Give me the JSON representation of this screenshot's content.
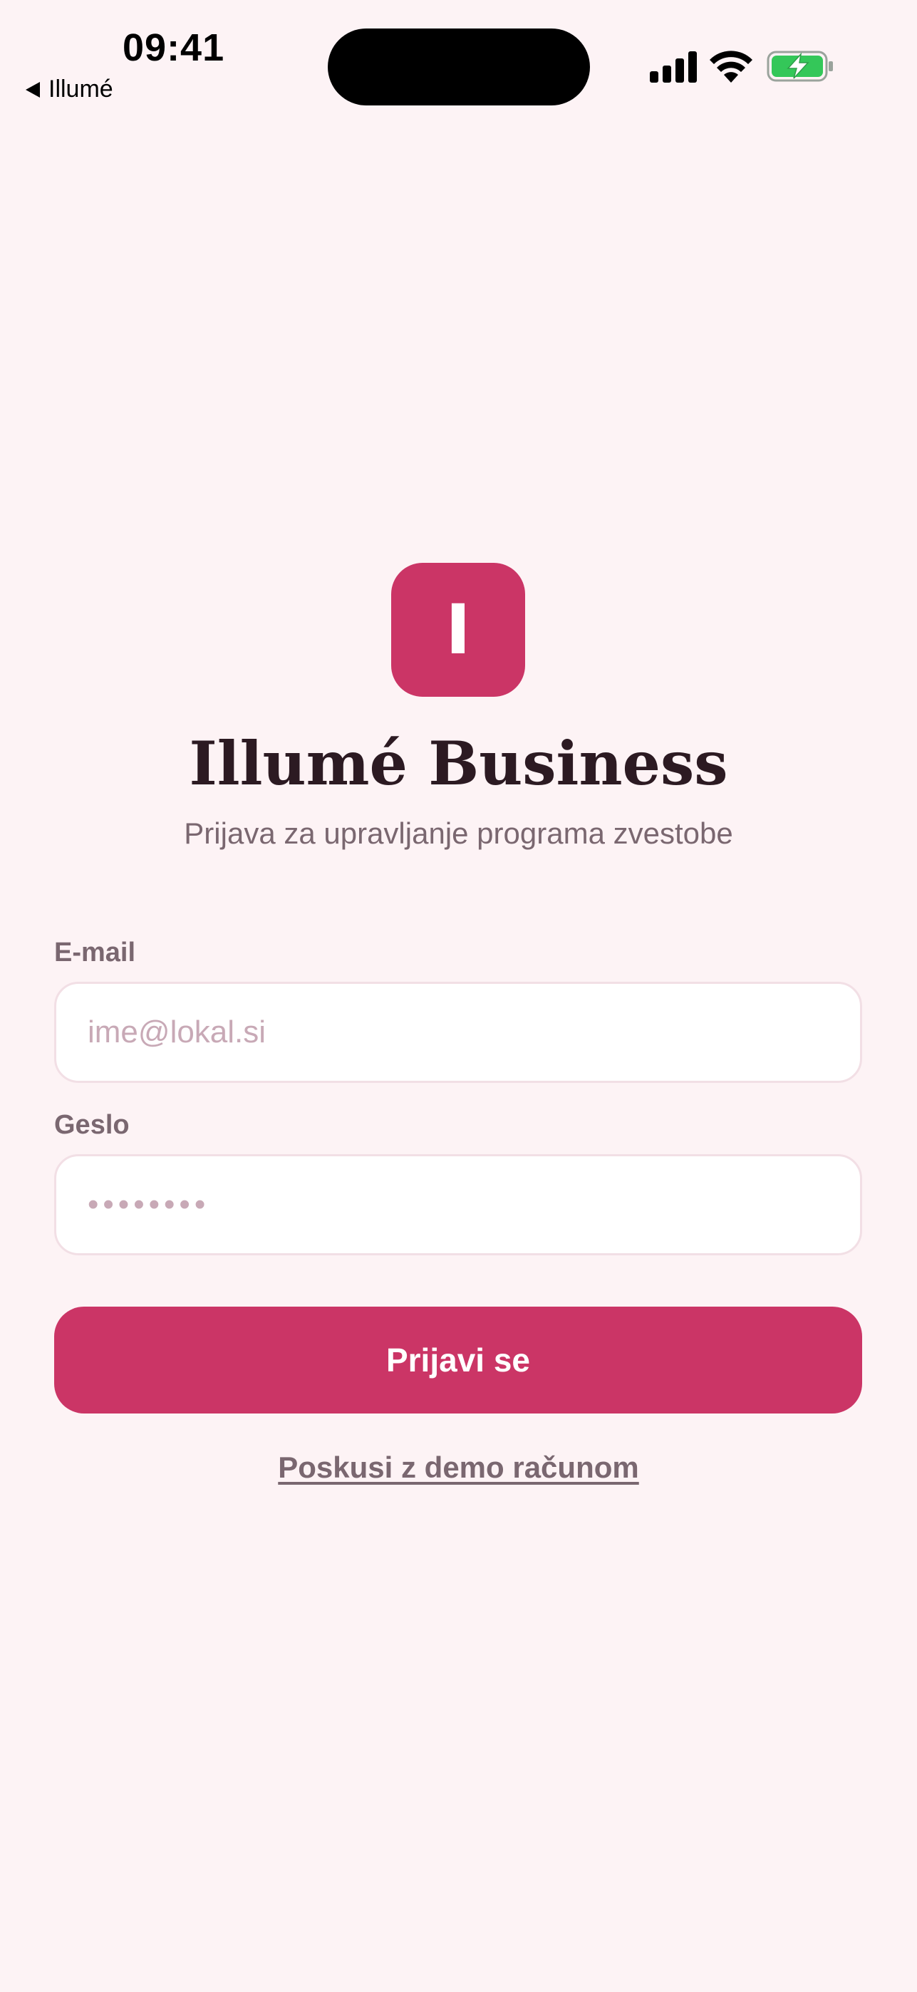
{
  "status_bar": {
    "time": "09:41",
    "back_label": "Illumé",
    "icons": [
      "cellular-signal-icon",
      "wifi-icon",
      "battery-charging-icon"
    ],
    "battery_color": "#34c759"
  },
  "brand": {
    "logo_letter": "I",
    "title": "Illumé Business",
    "subtitle": "Prijava za upravljanje programa zvestobe",
    "accent_color": "#cb3566"
  },
  "form": {
    "email": {
      "label": "E-mail",
      "placeholder": "ime@lokal.si",
      "value": ""
    },
    "password": {
      "label": "Geslo",
      "placeholder": "••••••••",
      "value": ""
    },
    "submit_label": "Prijavi se",
    "demo_link_label": "Poskusi z demo računom"
  }
}
